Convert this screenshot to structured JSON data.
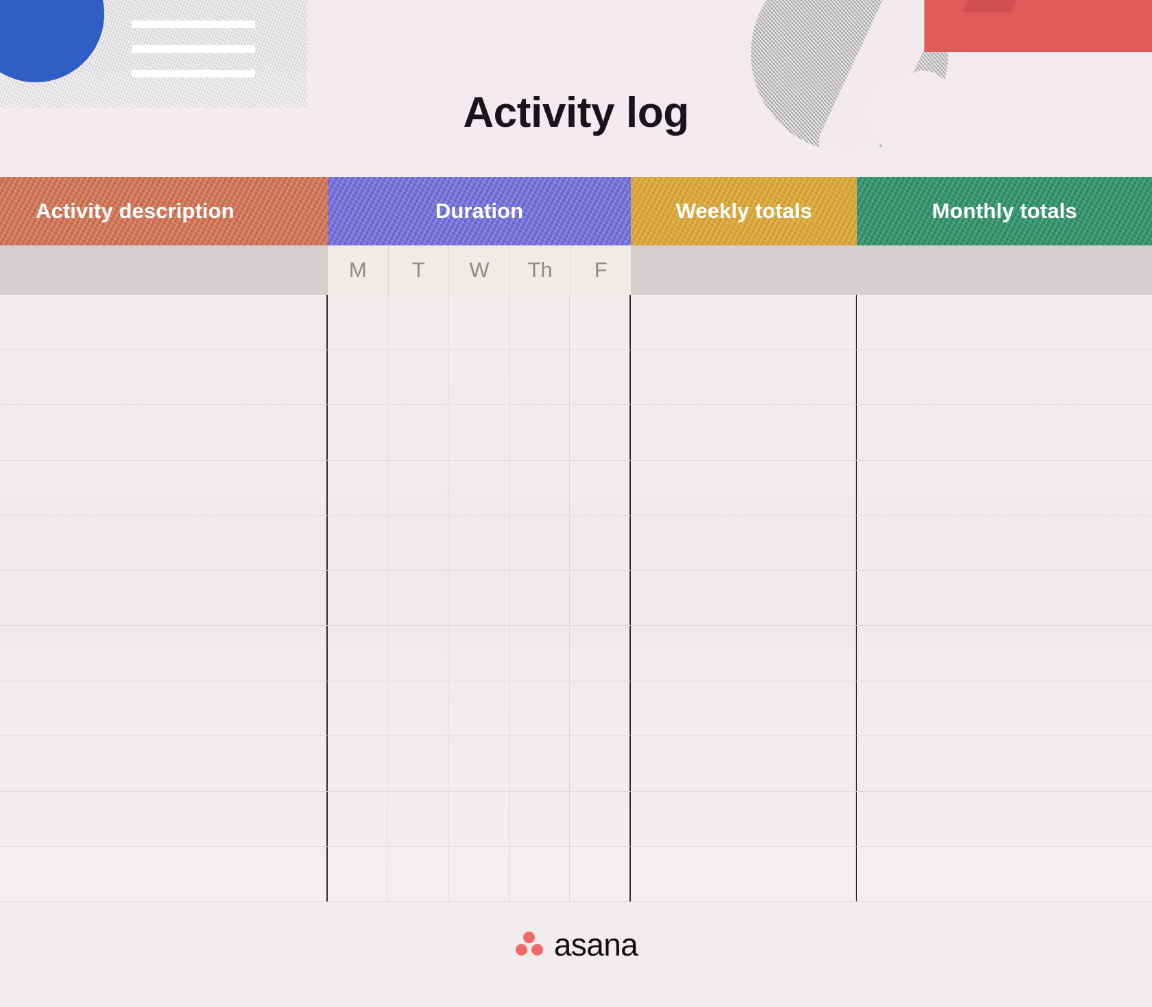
{
  "page": {
    "title": "Activity log",
    "background_color": "#f4ecf0"
  },
  "decorations": {
    "blue_circle_color": "#2f5ec4",
    "red_rect_color": "#e05a5a",
    "gray_circle_color": "#b9b6ba",
    "texture_rect_color": "#dedadd",
    "white_lines_count": 3
  },
  "table": {
    "headers": [
      {
        "label": "Activity description",
        "color": "#cd7559"
      },
      {
        "label": "Duration",
        "color": "#7572d6"
      },
      {
        "label": "Weekly totals",
        "color": "#d8a53f"
      },
      {
        "label": "Monthly totals",
        "color": "#39916f"
      }
    ],
    "day_columns": [
      "M",
      "T",
      "W",
      "Th",
      "F"
    ],
    "row_count": 11,
    "rows": [
      {
        "activity": "",
        "days": [
          "",
          "",
          "",
          "",
          ""
        ],
        "weekly": "",
        "monthly": ""
      },
      {
        "activity": "",
        "days": [
          "",
          "",
          "",
          "",
          ""
        ],
        "weekly": "",
        "monthly": ""
      },
      {
        "activity": "",
        "days": [
          "",
          "",
          "",
          "",
          ""
        ],
        "weekly": "",
        "monthly": ""
      },
      {
        "activity": "",
        "days": [
          "",
          "",
          "",
          "",
          ""
        ],
        "weekly": "",
        "monthly": ""
      },
      {
        "activity": "",
        "days": [
          "",
          "",
          "",
          "",
          ""
        ],
        "weekly": "",
        "monthly": ""
      },
      {
        "activity": "",
        "days": [
          "",
          "",
          "",
          "",
          ""
        ],
        "weekly": "",
        "monthly": ""
      },
      {
        "activity": "",
        "days": [
          "",
          "",
          "",
          "",
          ""
        ],
        "weekly": "",
        "monthly": ""
      },
      {
        "activity": "",
        "days": [
          "",
          "",
          "",
          "",
          ""
        ],
        "weekly": "",
        "monthly": ""
      },
      {
        "activity": "",
        "days": [
          "",
          "",
          "",
          "",
          ""
        ],
        "weekly": "",
        "monthly": ""
      },
      {
        "activity": "",
        "days": [
          "",
          "",
          "",
          "",
          ""
        ],
        "weekly": "",
        "monthly": ""
      },
      {
        "activity": "",
        "days": [
          "",
          "",
          "",
          "",
          ""
        ],
        "weekly": "",
        "monthly": ""
      }
    ]
  },
  "footer": {
    "brand": "asana",
    "logo_color": "#f06a6a"
  }
}
